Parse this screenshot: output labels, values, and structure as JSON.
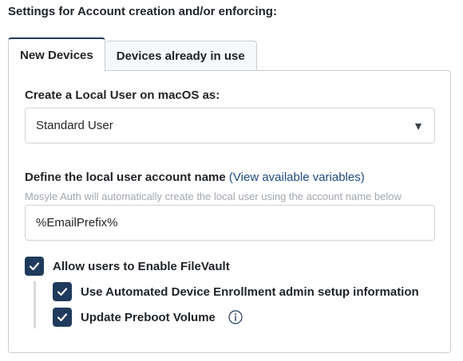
{
  "header": {
    "title": "Settings for Account creation and/or enforcing:"
  },
  "tabs": [
    {
      "label": "New Devices",
      "active": true
    },
    {
      "label": "Devices already in use",
      "active": false
    }
  ],
  "form": {
    "local_user_label": "Create a Local User on macOS as:",
    "local_user_select": {
      "value": "Standard User"
    },
    "account_name_label": "Define the local user account name",
    "variables_link": "(View available variables)",
    "account_name_hint": "Mosyle Auth will automatically create the local user using the account name below",
    "account_name_value": "%EmailPrefix%"
  },
  "checkboxes": {
    "filevault": {
      "label": "Allow users to Enable FileVault",
      "checked": true
    },
    "ade_admin": {
      "label": "Use Automated Device Enrollment admin setup information",
      "checked": true
    },
    "preboot": {
      "label": "Update Preboot Volume",
      "checked": true
    }
  },
  "colors": {
    "accent": "#1f3a5c",
    "link": "#1f4a82",
    "hint": "#a2a7ad",
    "border": "#c9cdd1"
  },
  "icons": {
    "dropdown": "triangle-down-icon",
    "check": "checkmark-icon",
    "info": "info-circle-icon"
  }
}
